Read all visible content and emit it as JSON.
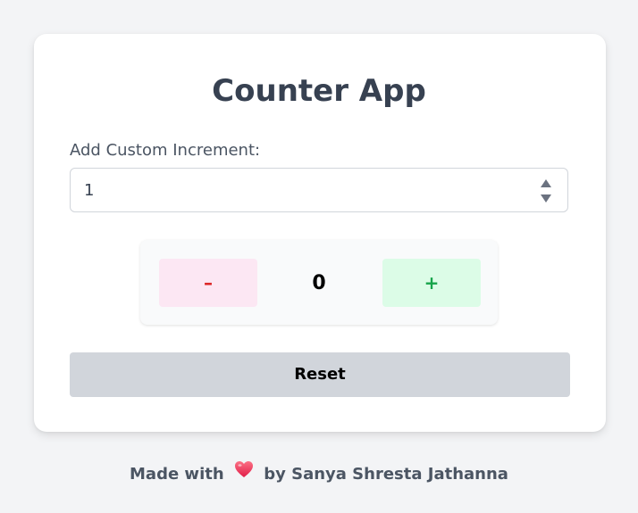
{
  "app": {
    "title": "Counter App"
  },
  "increment": {
    "label": "Add Custom Increment:",
    "value": "1"
  },
  "counter": {
    "decrement_label": "–",
    "count": "0",
    "increment_label": "+"
  },
  "reset": {
    "label": "Reset"
  },
  "footer": {
    "prefix": "Made with",
    "icon": "heart-icon",
    "suffix": "by Sanya Shresta Jathanna"
  },
  "colors": {
    "background": "#f3f4f6",
    "card": "#ffffff",
    "title_text": "#374151",
    "decrement_bg": "#fce7f3",
    "decrement_text": "#dc2626",
    "increment_bg": "#dcfce7",
    "increment_text": "#16a34a",
    "reset_bg": "#d1d5db",
    "heart": "#e11d48"
  }
}
